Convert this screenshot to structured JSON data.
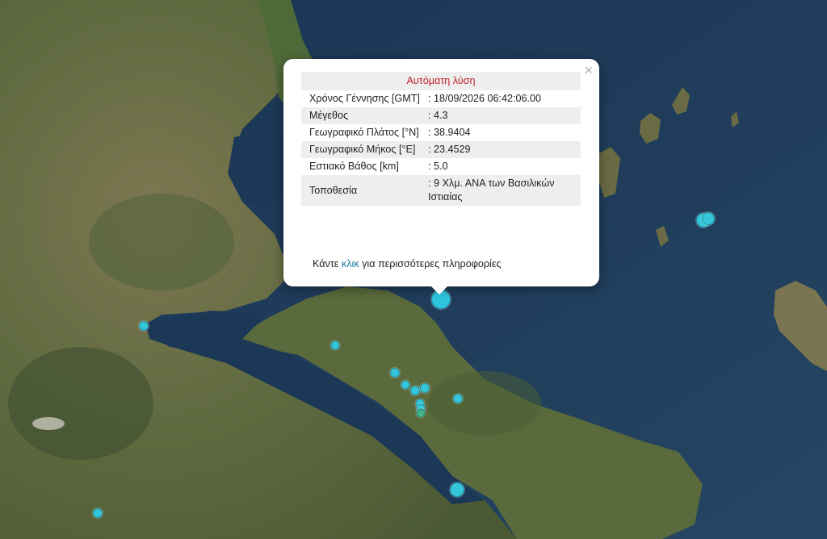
{
  "popup": {
    "title": "Αυτόματη λύση",
    "close_symbol": "×",
    "rows": [
      {
        "label": "Χρόνος Γέννησης [GMT]",
        "value": ": 18/09/2026 06:42:06.00"
      },
      {
        "label": "Μέγεθος",
        "value": ": 4.3"
      },
      {
        "label": "Γεωγραφικό Πλάτος [°N]",
        "value": ": 38.9404"
      },
      {
        "label": "Γεωγραφικό Μήκος [°E]",
        "value": ": 23.4529"
      },
      {
        "label": "Εστιακό Βάθος [km]",
        "value": ": 5.0"
      },
      {
        "label": "Τοποθεσία",
        "value": ": 9 Χλμ. ΑΝΑ των Βασιλικών Ιστιαίας"
      }
    ],
    "more_prefix": "Κάντε ",
    "more_link": "κλικ",
    "more_suffix": " για περισσότερες πληροφορίες"
  },
  "colors": {
    "sea": "#1f3b5a",
    "land": "#6b6a45",
    "marker": "#35c7d9",
    "title_red": "#c0202a",
    "link": "#1a7a9a"
  }
}
